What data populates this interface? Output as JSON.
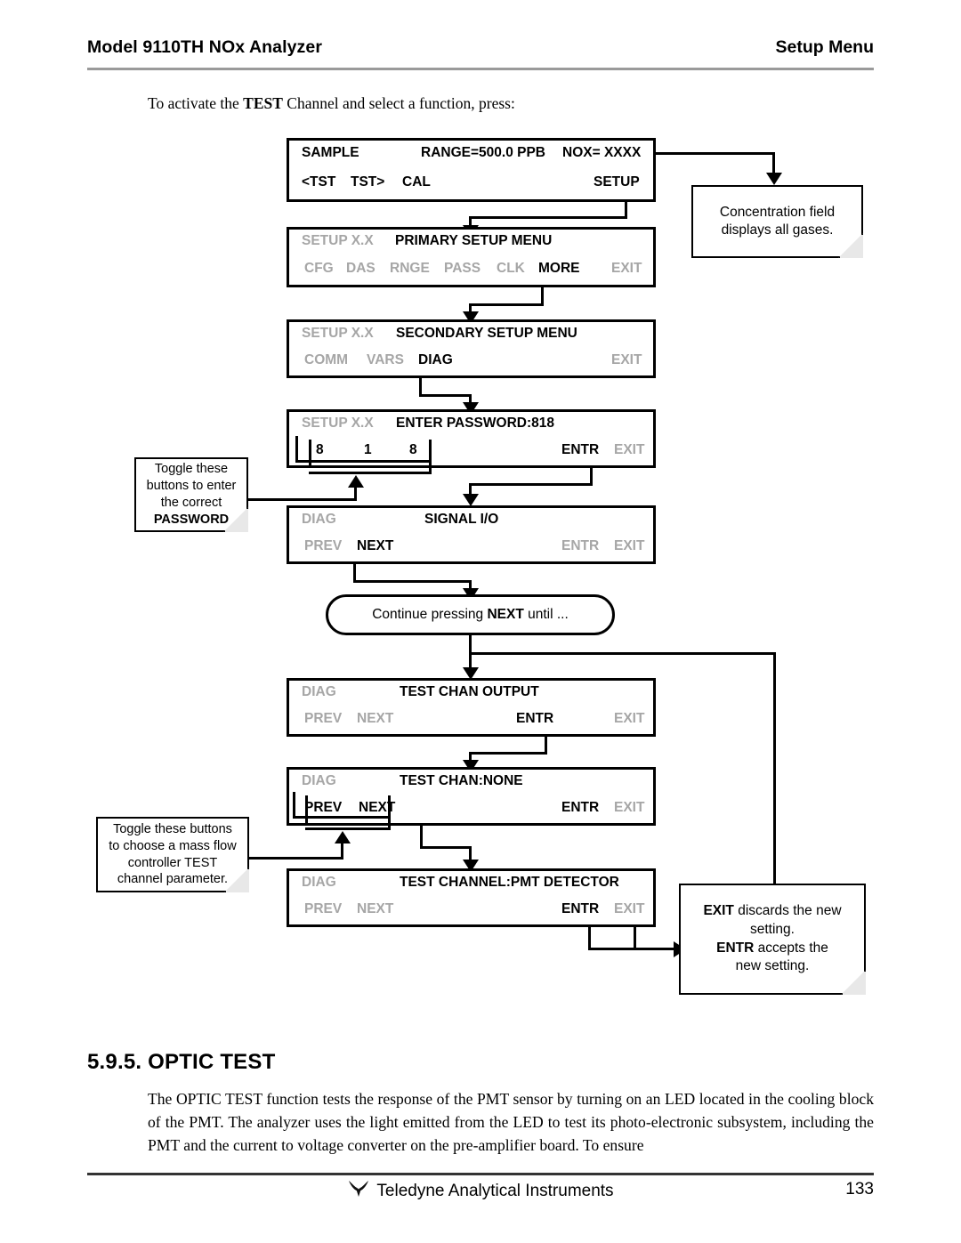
{
  "header": {
    "left": "Model 9110TH NOx Analyzer",
    "right": "Setup Menu"
  },
  "intro": {
    "before": "To activate the ",
    "bold": "TEST",
    "after": " Channel and select a function, press:"
  },
  "panels": [
    {
      "id": "sample",
      "top_left": "SAMPLE",
      "top_mid": "RANGE=500.0 PPB",
      "top_right": "NOX= XXXX",
      "btn1": "<TST",
      "btn2": "TST>",
      "btn3": "CAL",
      "btn_right": "SETUP"
    },
    {
      "id": "primary-setup",
      "top_left": "SETUP X.X",
      "title": "PRIMARY SETUP MENU",
      "b1": "CFG",
      "b2": "DAS",
      "b3": "RNGE",
      "b4": "PASS",
      "b5": "CLK",
      "b6": "MORE",
      "exit": "EXIT"
    },
    {
      "id": "secondary-setup",
      "top_left": "SETUP X.X",
      "title": "SECONDARY SETUP MENU",
      "b1": "COMM",
      "b2": "VARS",
      "b3": "DIAG",
      "exit": "EXIT"
    },
    {
      "id": "enter-password",
      "top_left": "SETUP X.X",
      "title": "ENTER PASSWORD:818",
      "d1": "8",
      "d2": "1",
      "d3": "8",
      "entr": "ENTR",
      "exit": "EXIT"
    },
    {
      "id": "signal-io",
      "top_left": "DIAG",
      "title": "SIGNAL I/O",
      "prev": "PREV",
      "next": "NEXT",
      "entr": "ENTR",
      "exit": "EXIT"
    },
    {
      "id": "test-chan-output",
      "top_left": "DIAG",
      "title": "TEST CHAN OUTPUT",
      "prev": "PREV",
      "next": "NEXT",
      "entr": "ENTR",
      "exit": "EXIT"
    },
    {
      "id": "test-chan-none",
      "top_left": "DIAG",
      "title": "TEST CHAN:NONE",
      "prev": "PREV",
      "next": "NEXT",
      "entr": "ENTR",
      "exit": "EXIT"
    },
    {
      "id": "test-channel-pmt",
      "top_left": "DIAG",
      "title": "TEST CHANNEL:PMT DETECTOR",
      "prev": "PREV",
      "next": "NEXT",
      "entr": "ENTR",
      "exit": "EXIT"
    }
  ],
  "notes": {
    "concentration": {
      "line1": "Concentration field",
      "line2": "displays all gases."
    },
    "password": {
      "line1": "Toggle these",
      "line2": "buttons to enter",
      "line3": "the correct",
      "line4": "PASSWORD"
    },
    "continue": {
      "before": "Continue pressing ",
      "bold": "NEXT",
      "after": "  until ..."
    },
    "massflow": {
      "line1": "Toggle these buttons",
      "line2": "to choose a mass flow",
      "line3": "controller TEST",
      "line4": "channel parameter."
    },
    "exitentr": {
      "b1": "EXIT",
      "t1": " discards the new",
      "l2": "setting.",
      "b2": "ENTR",
      "t2": " accepts the",
      "l3": "new setting."
    }
  },
  "section": {
    "heading": "5.9.5. OPTIC TEST",
    "paragraph": "The OPTIC TEST function tests the response of the PMT sensor by turning on an LED located in the cooling block of the PMT. The analyzer uses the light emitted from the LED to test its photo-electronic subsystem, including the PMT and the current to voltage converter on the pre-amplifier board. To ensure"
  },
  "footer": {
    "company": "Teledyne Analytical Instruments",
    "page": "133"
  }
}
